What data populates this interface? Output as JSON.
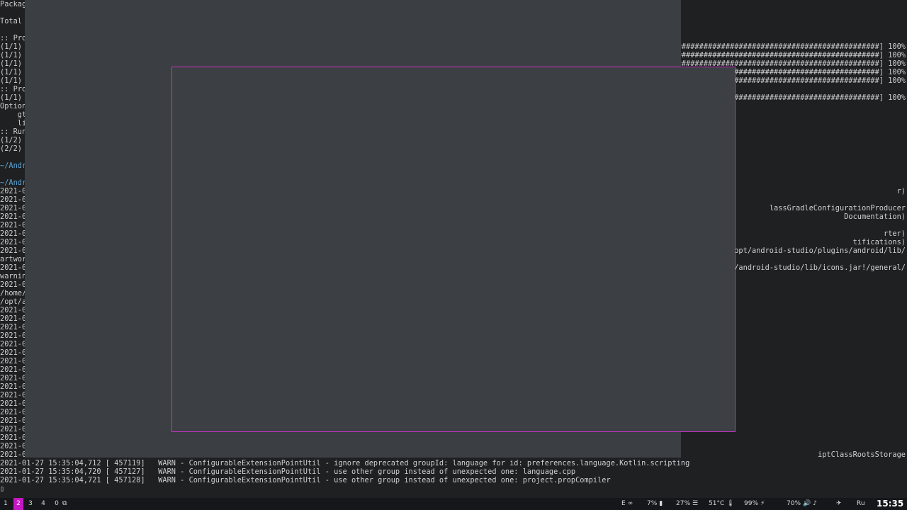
{
  "terminal": {
    "left_lines": [
      {
        "text": "Packag",
        "path": false
      },
      {
        "text": "",
        "path": false
      },
      {
        "text": "Total",
        "path": false
      },
      {
        "text": "",
        "path": false
      },
      {
        "text": ":: Pro",
        "path": false
      },
      {
        "text": "(1/1)",
        "path": false
      },
      {
        "text": "(1/1)",
        "path": false
      },
      {
        "text": "(1/1)",
        "path": false
      },
      {
        "text": "(1/1)",
        "path": false
      },
      {
        "text": "(1/1)",
        "path": false
      },
      {
        "text": ":: Pro",
        "path": false
      },
      {
        "text": "(1/1)",
        "path": false
      },
      {
        "text": "Option",
        "path": false
      },
      {
        "text": "    gt",
        "path": false
      },
      {
        "text": "    li",
        "path": false
      },
      {
        "text": ":: Run",
        "path": false
      },
      {
        "text": "(1/2)",
        "path": false
      },
      {
        "text": "(2/2)",
        "path": false
      },
      {
        "text": "",
        "path": false
      },
      {
        "text": "~/Andr",
        "path": true
      },
      {
        "text": "",
        "path": false
      },
      {
        "text": "~/Andr",
        "path": true
      },
      {
        "text": "2021-0",
        "path": false
      },
      {
        "text": "2021-0",
        "path": false
      },
      {
        "text": "2021-0",
        "path": false
      },
      {
        "text": "2021-0",
        "path": false
      },
      {
        "text": "2021-0",
        "path": false
      },
      {
        "text": "2021-0",
        "path": false
      },
      {
        "text": "2021-0",
        "path": false
      },
      {
        "text": "2021-0",
        "path": false
      },
      {
        "text": "artwor",
        "path": false
      },
      {
        "text": "2021-0",
        "path": false
      },
      {
        "text": "warnin",
        "path": false
      },
      {
        "text": "2021-0",
        "path": false
      },
      {
        "text": "/home/",
        "path": false
      },
      {
        "text": "/opt/a",
        "path": false
      },
      {
        "text": "2021-0",
        "path": false
      },
      {
        "text": "2021-0",
        "path": false
      },
      {
        "text": "2021-0",
        "path": false
      },
      {
        "text": "2021-0",
        "path": false
      },
      {
        "text": "2021-0",
        "path": false
      },
      {
        "text": "2021-0",
        "path": false
      },
      {
        "text": "2021-0",
        "path": false
      },
      {
        "text": "2021-0",
        "path": false
      },
      {
        "text": "2021-0",
        "path": false
      },
      {
        "text": "2021-0",
        "path": false
      },
      {
        "text": "2021-0",
        "path": false
      },
      {
        "text": "2021-0",
        "path": false
      },
      {
        "text": "2021-0",
        "path": false
      },
      {
        "text": "2021-0",
        "path": false
      },
      {
        "text": "2021-0",
        "path": false
      },
      {
        "text": "2021-0",
        "path": false
      },
      {
        "text": "2021-0",
        "path": false
      },
      {
        "text": "2021-0",
        "path": false
      }
    ],
    "right_lines": [
      {
        "row": 5,
        "text": "###############################################] 100%"
      },
      {
        "row": 6,
        "text": "###############################################] 100%"
      },
      {
        "row": 7,
        "text": "###############################################] 100%"
      },
      {
        "row": 8,
        "text": "###############################################] 100%"
      },
      {
        "row": 9,
        "text": "###############################################] 100%"
      },
      {
        "row": 11,
        "text": "###############################################] 100%"
      },
      {
        "row": 22,
        "text": "r)"
      },
      {
        "row": 24,
        "text": "lassGradleConfigurationProducer"
      },
      {
        "row": 25,
        "text": "Documentation)"
      },
      {
        "row": 27,
        "text": "rter)"
      },
      {
        "row": 28,
        "text": "tifications)"
      },
      {
        "row": 29,
        "text": "/opt/android-studio/plugins/android/lib/"
      },
      {
        "row": 31,
        "text": "t/android-studio/lib/icons.jar!/general/"
      },
      {
        "row": 53,
        "text": "iptClassRootsStorage"
      }
    ],
    "bottom_lines": [
      "2021-01-27 15:35:04,712 [ 457119]   WARN - ConfigurableExtensionPointUtil - ignore deprecated groupId: language for id: preferences.language.Kotlin.scripting",
      "2021-01-27 15:35:04,720 [ 457127]   WARN - ConfigurableExtensionPointUtil - use other group instead of unexpected one: language.cpp",
      "2021-01-27 15:35:04,721 [ 457128]   WARN - ConfigurableExtensionPointUtil - use other group instead of unexpected one: project.propCompiler"
    ],
    "prompt_text": "▯"
  },
  "bar": {
    "workspaces": [
      "1",
      "2",
      "3",
      "4",
      "0"
    ],
    "active_workspace": "2",
    "status": {
      "layout": "E",
      "cpu": "7%",
      "mem": "27%",
      "temp": "51°C",
      "battery": "99%",
      "volume": "70%",
      "lang": "Ru",
      "clock": "15:35"
    }
  },
  "colors": {
    "accent": "#c418c4",
    "float_border": "#c933c9",
    "window_bg": "#3c3f43",
    "terminal_bg": "#1f2022"
  }
}
